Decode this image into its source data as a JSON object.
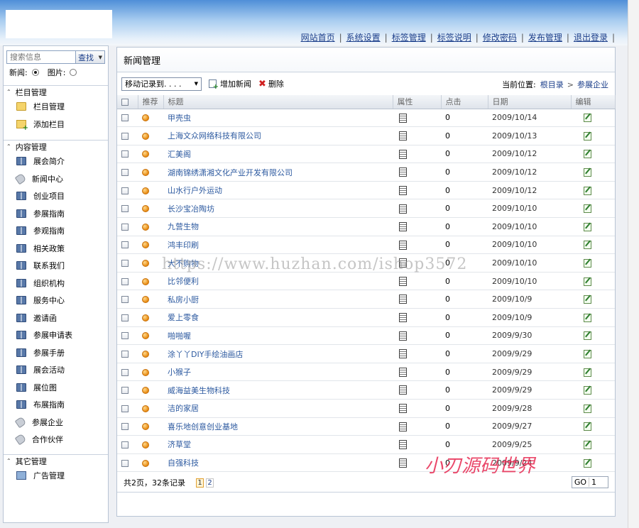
{
  "header": {
    "nav": [
      "网站首页",
      "系统设置",
      "标签管理",
      "标签说明",
      "修改密码",
      "发布管理",
      "退出登录"
    ],
    "separator": "|"
  },
  "sidebar": {
    "search": {
      "placeholder": "搜索信息",
      "button": "查找"
    },
    "radio": {
      "news_label": "新闻:",
      "image_label": "图片:",
      "selected": "news"
    },
    "sections": [
      {
        "title": "栏目管理",
        "items": [
          {
            "label": "栏目管理",
            "icon": "folder-icon"
          },
          {
            "label": "添加栏目",
            "icon": "folder-add-icon"
          }
        ]
      },
      {
        "title": "内容管理",
        "items": [
          {
            "label": "展会简介",
            "icon": "book-icon"
          },
          {
            "label": "新闻中心",
            "icon": "tag-icon"
          },
          {
            "label": "创业项目",
            "icon": "book-icon"
          },
          {
            "label": "参展指南",
            "icon": "book-icon"
          },
          {
            "label": "参观指南",
            "icon": "book-icon"
          },
          {
            "label": "相关政策",
            "icon": "book-icon"
          },
          {
            "label": "联系我们",
            "icon": "book-icon"
          },
          {
            "label": "组织机构",
            "icon": "book-icon"
          },
          {
            "label": "服务中心",
            "icon": "book-icon"
          },
          {
            "label": "邀请函",
            "icon": "book-icon"
          },
          {
            "label": "参展申请表",
            "icon": "book-icon"
          },
          {
            "label": "参展手册",
            "icon": "book-icon"
          },
          {
            "label": "展会活动",
            "icon": "book-icon"
          },
          {
            "label": "展位图",
            "icon": "book-icon"
          },
          {
            "label": "布展指南",
            "icon": "book-icon"
          },
          {
            "label": "参展企业",
            "icon": "tag-icon"
          },
          {
            "label": "合作伙伴",
            "icon": "tag-icon"
          }
        ]
      },
      {
        "title": "其它管理",
        "items": [
          {
            "label": "广告管理",
            "icon": "monitor-icon"
          }
        ]
      }
    ]
  },
  "main": {
    "title": "新闻管理",
    "toolbar": {
      "move_select": "移动记录到. . . .",
      "add_label": "增加新闻",
      "delete_label": "删除"
    },
    "location": {
      "label": "当前位置:",
      "root": "根目录",
      "sep": ">",
      "current": "参展企业"
    },
    "columns": [
      "推荐",
      "标题",
      "属性",
      "点击",
      "日期",
      "编辑"
    ],
    "rows": [
      {
        "title": "甲壳虫",
        "clicks": "0",
        "date": "2009/10/14"
      },
      {
        "title": "上海文众网络科技有限公司",
        "clicks": "0",
        "date": "2009/10/13"
      },
      {
        "title": "汇美阁",
        "clicks": "0",
        "date": "2009/10/12"
      },
      {
        "title": "湖南锦绣潇湘文化产业开发有限公司",
        "clicks": "0",
        "date": "2009/10/12"
      },
      {
        "title": "山水行户外运动",
        "clicks": "0",
        "date": "2009/10/12"
      },
      {
        "title": "长沙宝冶陶坊",
        "clicks": "0",
        "date": "2009/10/10"
      },
      {
        "title": "九营生物",
        "clicks": "0",
        "date": "2009/10/10"
      },
      {
        "title": "鸿丰印刷",
        "clicks": "0",
        "date": "2009/10/10"
      },
      {
        "title": "大不购物",
        "clicks": "0",
        "date": "2009/10/10"
      },
      {
        "title": "比邻便利",
        "clicks": "0",
        "date": "2009/10/10"
      },
      {
        "title": "私房小厨",
        "clicks": "0",
        "date": "2009/10/9"
      },
      {
        "title": "爱上零食",
        "clicks": "0",
        "date": "2009/10/9"
      },
      {
        "title": "啪啪喔",
        "clicks": "0",
        "date": "2009/9/30"
      },
      {
        "title": "涂丫丫DIY手绘油画店",
        "clicks": "0",
        "date": "2009/9/29"
      },
      {
        "title": "小猴子",
        "clicks": "0",
        "date": "2009/9/29"
      },
      {
        "title": "威海益美生物科技",
        "clicks": "0",
        "date": "2009/9/29"
      },
      {
        "title": "洁的家居",
        "clicks": "0",
        "date": "2009/9/28"
      },
      {
        "title": "喜乐地创意创业基地",
        "clicks": "0",
        "date": "2009/9/27"
      },
      {
        "title": "济草堂",
        "clicks": "0",
        "date": "2009/9/25"
      },
      {
        "title": "自强科技",
        "clicks": "0",
        "date": "2009/9/24"
      }
    ],
    "pager": {
      "summary": "共2页，32条记录",
      "pages": [
        "1",
        "2"
      ],
      "current": "1",
      "go_label": "GO",
      "go_value": "1"
    }
  },
  "watermarks": {
    "url": "https://www.huzhan.com/ishop3572",
    "brand": "小刃源码世界"
  }
}
